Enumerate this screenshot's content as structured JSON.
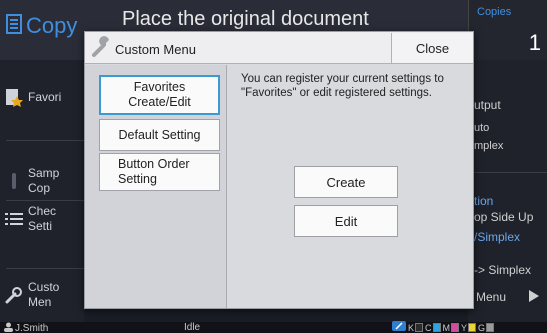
{
  "app": {
    "title": "Copy",
    "instruction": "Place the original document",
    "copies_label": "Copies",
    "copies_value": "1"
  },
  "left_panel": {
    "items": [
      {
        "label": "Favori"
      },
      {
        "label": "Samp\nCop"
      },
      {
        "label": "Chec\nSetti"
      },
      {
        "label": "Custo\nMen"
      }
    ]
  },
  "right_panel": {
    "output_label": "utput",
    "auto": "uto",
    "simplex": "mplex",
    "orientation": "tion",
    "top_side_up": "op Side Up",
    "simplex_label": "/Simplex",
    "to_simplex": "-> Simplex",
    "menu": "Menu"
  },
  "status_bar": {
    "user": "J.Smith",
    "status": "Idle",
    "inks": [
      {
        "label": "K",
        "color": "#2b2b2b"
      },
      {
        "label": "C",
        "color": "#2fa3dc"
      },
      {
        "label": "M",
        "color": "#d64aa1"
      },
      {
        "label": "Y",
        "color": "#e9d434"
      },
      {
        "label": "G",
        "color": "#9a9a9a"
      }
    ]
  },
  "dialog": {
    "title": "Custom Menu",
    "close_label": "Close",
    "menu": [
      {
        "label": "Favorites\nCreate/Edit",
        "selected": true
      },
      {
        "label": "Default Setting",
        "selected": false
      },
      {
        "label": "Button Order\nSetting",
        "selected": false
      }
    ],
    "description": "You can register your current settings to \"Favorites\" or edit registered settings.",
    "create_label": "Create",
    "edit_label": "Edit"
  },
  "colors": {
    "accent": "#3a9bd4",
    "brand_blue": "#3f8ee0"
  }
}
